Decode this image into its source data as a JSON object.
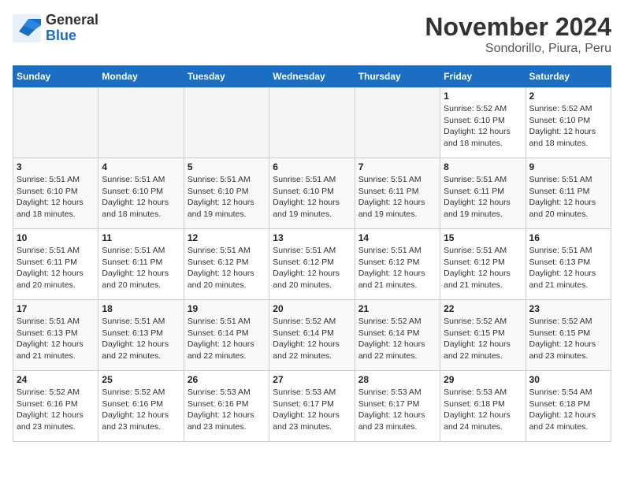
{
  "logo": {
    "general": "General",
    "blue": "Blue"
  },
  "title": "November 2024",
  "subtitle": "Sondorillo, Piura, Peru",
  "weekdays": [
    "Sunday",
    "Monday",
    "Tuesday",
    "Wednesday",
    "Thursday",
    "Friday",
    "Saturday"
  ],
  "weeks": [
    [
      {
        "day": "",
        "info": ""
      },
      {
        "day": "",
        "info": ""
      },
      {
        "day": "",
        "info": ""
      },
      {
        "day": "",
        "info": ""
      },
      {
        "day": "",
        "info": ""
      },
      {
        "day": "1",
        "info": "Sunrise: 5:52 AM\nSunset: 6:10 PM\nDaylight: 12 hours and 18 minutes."
      },
      {
        "day": "2",
        "info": "Sunrise: 5:52 AM\nSunset: 6:10 PM\nDaylight: 12 hours and 18 minutes."
      }
    ],
    [
      {
        "day": "3",
        "info": "Sunrise: 5:51 AM\nSunset: 6:10 PM\nDaylight: 12 hours and 18 minutes."
      },
      {
        "day": "4",
        "info": "Sunrise: 5:51 AM\nSunset: 6:10 PM\nDaylight: 12 hours and 18 minutes."
      },
      {
        "day": "5",
        "info": "Sunrise: 5:51 AM\nSunset: 6:10 PM\nDaylight: 12 hours and 19 minutes."
      },
      {
        "day": "6",
        "info": "Sunrise: 5:51 AM\nSunset: 6:10 PM\nDaylight: 12 hours and 19 minutes."
      },
      {
        "day": "7",
        "info": "Sunrise: 5:51 AM\nSunset: 6:11 PM\nDaylight: 12 hours and 19 minutes."
      },
      {
        "day": "8",
        "info": "Sunrise: 5:51 AM\nSunset: 6:11 PM\nDaylight: 12 hours and 19 minutes."
      },
      {
        "day": "9",
        "info": "Sunrise: 5:51 AM\nSunset: 6:11 PM\nDaylight: 12 hours and 20 minutes."
      }
    ],
    [
      {
        "day": "10",
        "info": "Sunrise: 5:51 AM\nSunset: 6:11 PM\nDaylight: 12 hours and 20 minutes."
      },
      {
        "day": "11",
        "info": "Sunrise: 5:51 AM\nSunset: 6:11 PM\nDaylight: 12 hours and 20 minutes."
      },
      {
        "day": "12",
        "info": "Sunrise: 5:51 AM\nSunset: 6:12 PM\nDaylight: 12 hours and 20 minutes."
      },
      {
        "day": "13",
        "info": "Sunrise: 5:51 AM\nSunset: 6:12 PM\nDaylight: 12 hours and 20 minutes."
      },
      {
        "day": "14",
        "info": "Sunrise: 5:51 AM\nSunset: 6:12 PM\nDaylight: 12 hours and 21 minutes."
      },
      {
        "day": "15",
        "info": "Sunrise: 5:51 AM\nSunset: 6:12 PM\nDaylight: 12 hours and 21 minutes."
      },
      {
        "day": "16",
        "info": "Sunrise: 5:51 AM\nSunset: 6:13 PM\nDaylight: 12 hours and 21 minutes."
      }
    ],
    [
      {
        "day": "17",
        "info": "Sunrise: 5:51 AM\nSunset: 6:13 PM\nDaylight: 12 hours and 21 minutes."
      },
      {
        "day": "18",
        "info": "Sunrise: 5:51 AM\nSunset: 6:13 PM\nDaylight: 12 hours and 22 minutes."
      },
      {
        "day": "19",
        "info": "Sunrise: 5:51 AM\nSunset: 6:14 PM\nDaylight: 12 hours and 22 minutes."
      },
      {
        "day": "20",
        "info": "Sunrise: 5:52 AM\nSunset: 6:14 PM\nDaylight: 12 hours and 22 minutes."
      },
      {
        "day": "21",
        "info": "Sunrise: 5:52 AM\nSunset: 6:14 PM\nDaylight: 12 hours and 22 minutes."
      },
      {
        "day": "22",
        "info": "Sunrise: 5:52 AM\nSunset: 6:15 PM\nDaylight: 12 hours and 22 minutes."
      },
      {
        "day": "23",
        "info": "Sunrise: 5:52 AM\nSunset: 6:15 PM\nDaylight: 12 hours and 23 minutes."
      }
    ],
    [
      {
        "day": "24",
        "info": "Sunrise: 5:52 AM\nSunset: 6:16 PM\nDaylight: 12 hours and 23 minutes."
      },
      {
        "day": "25",
        "info": "Sunrise: 5:52 AM\nSunset: 6:16 PM\nDaylight: 12 hours and 23 minutes."
      },
      {
        "day": "26",
        "info": "Sunrise: 5:53 AM\nSunset: 6:16 PM\nDaylight: 12 hours and 23 minutes."
      },
      {
        "day": "27",
        "info": "Sunrise: 5:53 AM\nSunset: 6:17 PM\nDaylight: 12 hours and 23 minutes."
      },
      {
        "day": "28",
        "info": "Sunrise: 5:53 AM\nSunset: 6:17 PM\nDaylight: 12 hours and 23 minutes."
      },
      {
        "day": "29",
        "info": "Sunrise: 5:53 AM\nSunset: 6:18 PM\nDaylight: 12 hours and 24 minutes."
      },
      {
        "day": "30",
        "info": "Sunrise: 5:54 AM\nSunset: 6:18 PM\nDaylight: 12 hours and 24 minutes."
      }
    ]
  ]
}
